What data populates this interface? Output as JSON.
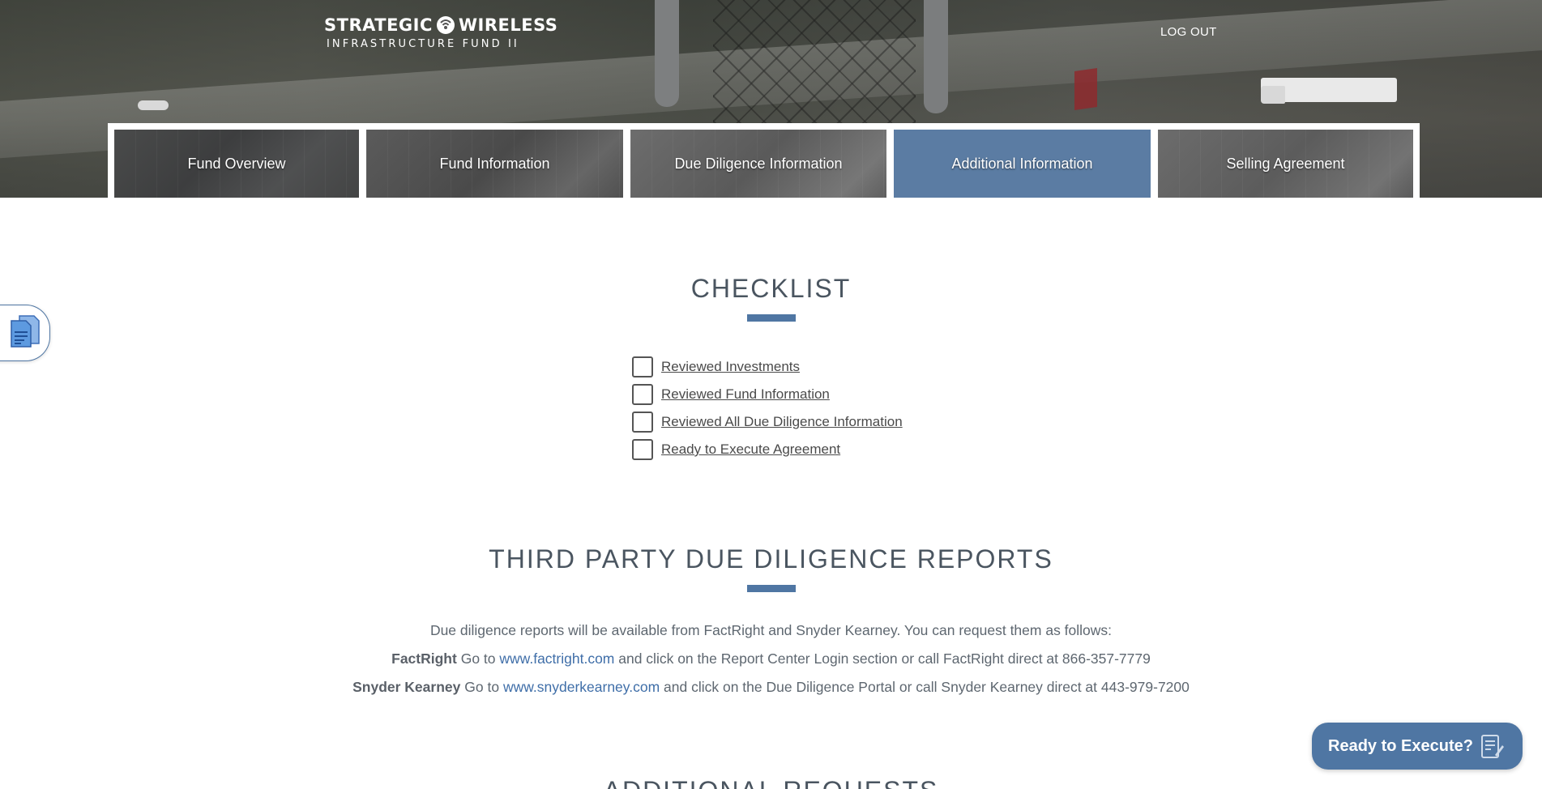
{
  "header": {
    "logo_line1_a": "STRATEGIC",
    "logo_line1_b": "WIRELESS",
    "logo_line2": "INFRASTRUCTURE FUND II",
    "logout_label": "LOG OUT"
  },
  "tabs": [
    {
      "label": "Fund Overview",
      "active": false
    },
    {
      "label": "Fund Information",
      "active": false
    },
    {
      "label": "Due Diligence Information",
      "active": false
    },
    {
      "label": "Additional Information",
      "active": true
    },
    {
      "label": "Selling Agreement",
      "active": false
    }
  ],
  "checklist": {
    "title": "CHECKLIST",
    "items": [
      {
        "label": "Reviewed Investments",
        "checked": false
      },
      {
        "label": "Reviewed Fund Information",
        "checked": false
      },
      {
        "label": "Reviewed All Due Diligence Information",
        "checked": false
      },
      {
        "label": "Ready to Execute Agreement",
        "checked": false
      }
    ]
  },
  "reports": {
    "title": "THIRD PARTY DUE DILIGENCE REPORTS",
    "intro": "Due diligence reports will be available from FactRight and Snyder Kearney. You can request them as follows:",
    "factright": {
      "name": "FactRight",
      "pre": "Go to",
      "link": "www.factright.com",
      "post": "and click on the Report Center Login section or call FactRight direct at 866-357-7779"
    },
    "snyder": {
      "name": "Snyder Kearney",
      "pre": "Go to",
      "link": "www.snyderkearney.com",
      "post": "and click on the Due Diligence Portal or call Snyder Kearney direct at 443-979-7200"
    }
  },
  "additional": {
    "title": "ADDITIONAL REQUESTS"
  },
  "ready_button": {
    "label": "Ready to Execute?"
  },
  "colors": {
    "accent": "#4f76a3",
    "active_tab": "#5b7ca3",
    "link": "#3f6ea8"
  }
}
